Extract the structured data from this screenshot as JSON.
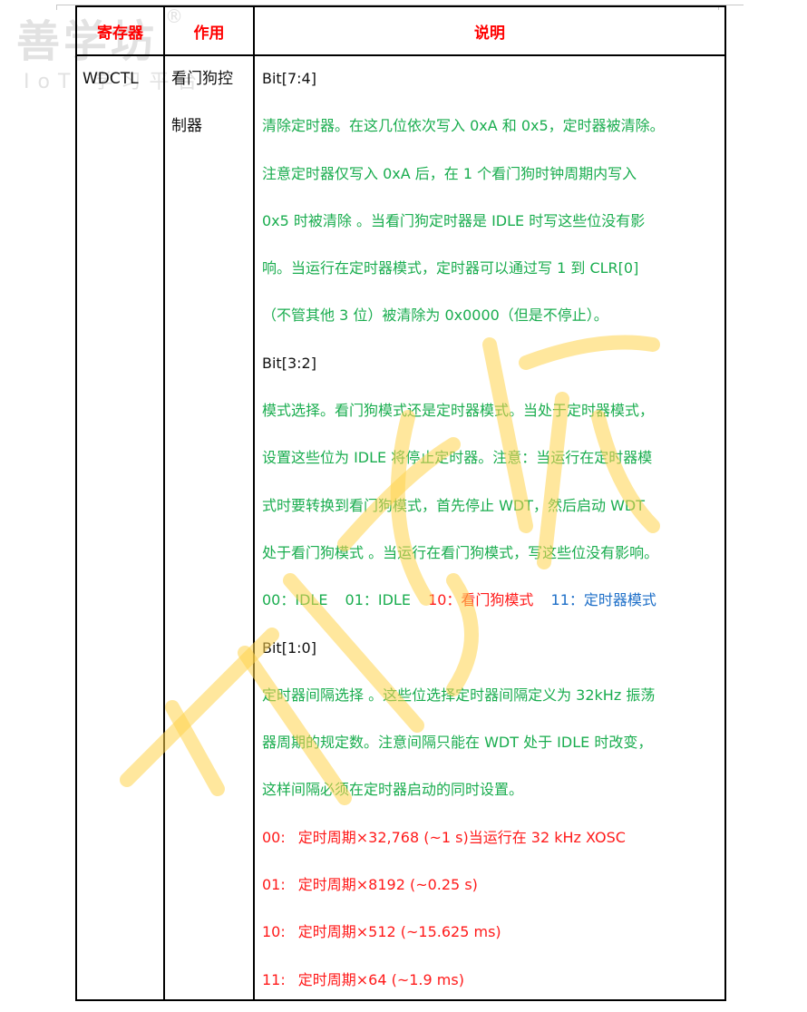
{
  "watermark": {
    "logo": "善学坊",
    "registered": "®",
    "subtitle": "IoT 学习平台"
  },
  "colors": {
    "header_text": "#ff0000",
    "description_text": "#1aad4f",
    "highlight_red": "#ff1a1a",
    "highlight_blue": "#1e6fc8",
    "border": "#000000"
  },
  "table": {
    "headers": [
      "寄存器",
      "作用",
      "说明"
    ],
    "row": {
      "register": "WDCTL",
      "function_line1": "看门狗控",
      "function_line2": "制器",
      "sections": [
        {
          "bits": "Bit[7:4]",
          "lines": [
            "清除定时器。在这几位依次写入 0xA 和 0x5，定时器被清除。",
            "注意定时器仅写入  0xA  后，在  1 个看门狗时钟周期内写入",
            "0x5  时被清除 。当看门狗定时器是  IDLE  时写这些位没有影",
            "响。当运行在定时器模式，定时器可以通过写  1  到  CLR[0]",
            "（不管其他  3 位）被清除为  0x0000（但是不停止）。"
          ]
        },
        {
          "bits": "Bit[3:2]",
          "lines": [
            "模式选择。看门狗模式还是定时器模式。当处于定时器模式，",
            "设置这些位为 IDLE 将停止定时器。注意：当运行在定时器模",
            "式时要转换到看门狗模式，首先停止 WDT，然后启动 WDT",
            "处于看门狗模式 。当运行在看门狗模式，写这些位没有影响。"
          ],
          "modes": [
            {
              "code": "00：IDLE",
              "color": "green"
            },
            {
              "code": "01：IDLE",
              "color": "green"
            },
            {
              "code": "10：看门狗模式",
              "color": "red"
            },
            {
              "code": "11：定时器模式",
              "color": "blue"
            }
          ]
        },
        {
          "bits": "Bit[1:0]",
          "lines": [
            "定时器间隔选择 。这些位选择定时器间隔定义为 32kHz 振荡",
            "器周期的规定数。注意间隔只能在 WDT 处于  IDLE 时改变，",
            "这样间隔必须在定时器启动的同时设置。"
          ],
          "intervals": [
            {
              "code": "00:",
              "text": "定时周期×32,768 (~1 s)当运行在 32 kHz XOSC"
            },
            {
              "code": "01:",
              "text": "定时周期×8192 (~0.25 s)"
            },
            {
              "code": "10:",
              "text": "定时周期×512 (~15.625 ms)"
            },
            {
              "code": "11:",
              "text": "定时周期×64 (~1.9 ms)"
            }
          ]
        }
      ]
    }
  }
}
